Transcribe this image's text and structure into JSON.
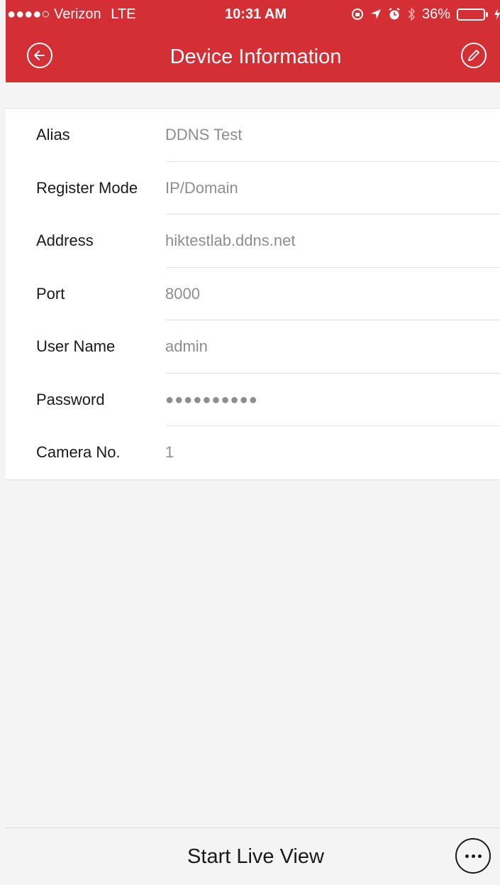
{
  "status_bar": {
    "signal_bars": 4,
    "signal_total": 5,
    "carrier": "Verizon",
    "network": "LTE",
    "time": "10:31 AM",
    "battery_percent_label": "36%",
    "battery_level": 0.36
  },
  "nav": {
    "title": "Device Information",
    "back_icon": "back-arrow-icon",
    "edit_icon": "pencil-icon"
  },
  "fields": [
    {
      "label": "Alias",
      "value": "DDNS Test"
    },
    {
      "label": "Register Mode",
      "value": "IP/Domain"
    },
    {
      "label": "Address",
      "value": "hiktestlab.ddns.net"
    },
    {
      "label": "Port",
      "value": "8000"
    },
    {
      "label": "User Name",
      "value": "admin"
    },
    {
      "label": "Password",
      "value": "●●●●●●●●●●"
    },
    {
      "label": "Camera No.",
      "value": "1"
    }
  ],
  "footer": {
    "start_live_view": "Start Live View",
    "more_icon": "more-ellipsis-icon"
  },
  "colors": {
    "accent": "#d32f35",
    "battery_fill": "#4cd964"
  }
}
